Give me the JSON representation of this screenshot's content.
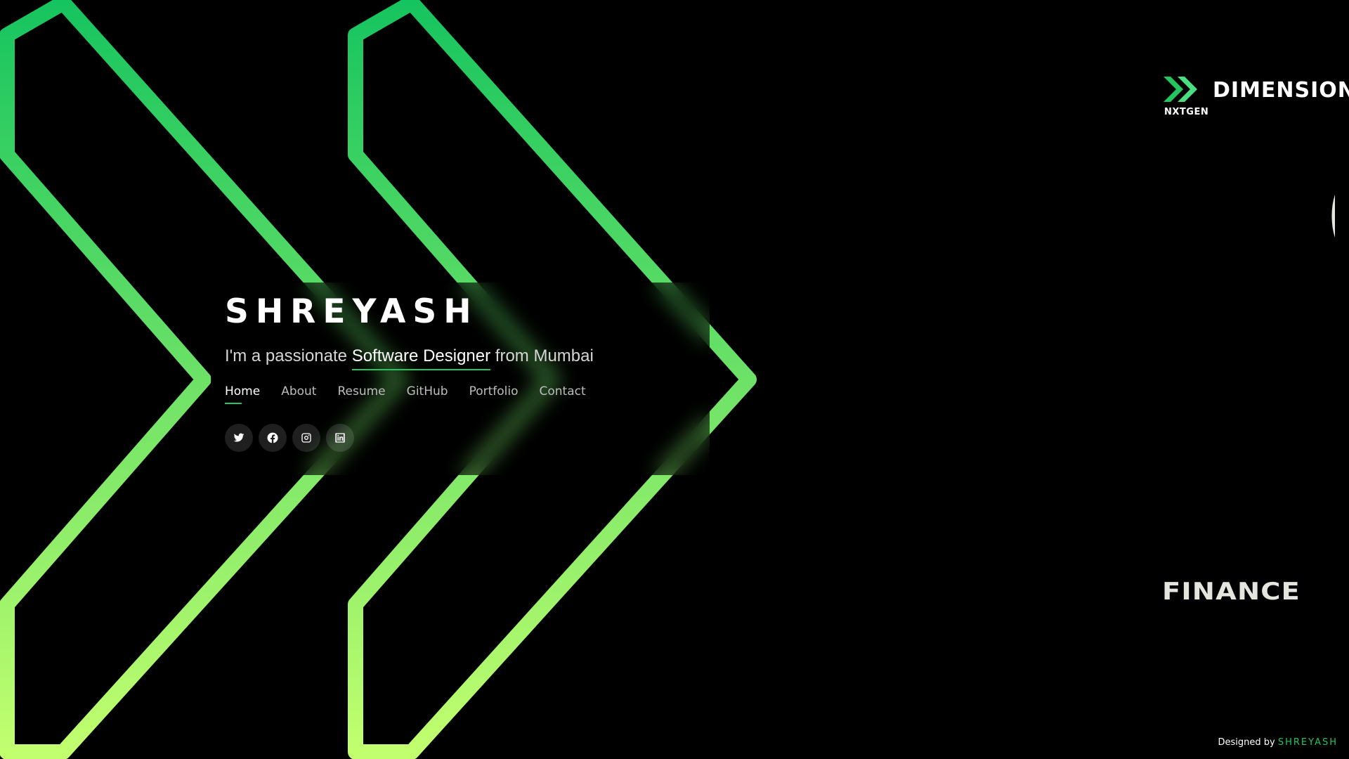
{
  "hero": {
    "name": "SHREYASH",
    "subtitle_pre": "I'm a passionate ",
    "subtitle_highlight": "Software Designer",
    "subtitle_post": " from Mumbai"
  },
  "nav": {
    "items": [
      {
        "label": "Home",
        "active": true
      },
      {
        "label": "About",
        "active": false
      },
      {
        "label": "Resume",
        "active": false
      },
      {
        "label": "GitHub",
        "active": false
      },
      {
        "label": "Portfolio",
        "active": false
      },
      {
        "label": "Contact",
        "active": false
      }
    ]
  },
  "socials": [
    "twitter-icon",
    "facebook-icon",
    "instagram-icon",
    "linkedin-icon"
  ],
  "brand": {
    "small": "NXTGEN",
    "name": "DIMENSION"
  },
  "poster": {
    "vertical_word": "ONE",
    "bottom_word": "FINANCE"
  },
  "footer": {
    "prefix": "Designed by ",
    "name": "SHREYASH"
  },
  "colors": {
    "background": "#000000",
    "accent": "#22c55e",
    "gradient_top": "#16c45f",
    "gradient_bottom": "#c2ff6f",
    "poster_text": "#e5e5e0"
  }
}
